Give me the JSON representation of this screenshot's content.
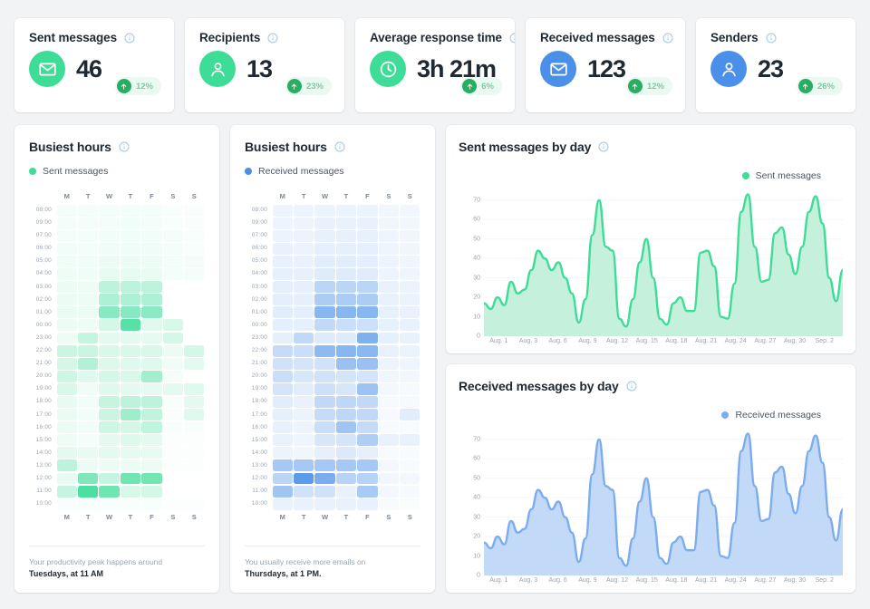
{
  "kpis": [
    {
      "title": "Sent messages",
      "value": "46",
      "trend": "12%",
      "icon": "envelope-icon",
      "bubble": "#3ddc97",
      "badge_bg": "#eafaf2"
    },
    {
      "title": "Recipients",
      "value": "13",
      "trend": "23%",
      "icon": "person-icon",
      "bubble": "#3ddc97",
      "badge_bg": "#eafaf2"
    },
    {
      "title": "Average response time",
      "value": "3h 21m",
      "trend": "6%",
      "icon": "clock-icon",
      "bubble": "#3ddc97",
      "badge_bg": "#eafaf2"
    },
    {
      "title": "Received messages",
      "value": "123",
      "trend": "12%",
      "icon": "envelope-icon",
      "bubble": "#4a90e8",
      "badge_bg": "#eafaf2"
    },
    {
      "title": "Senders",
      "value": "23",
      "trend": "26%",
      "icon": "person-icon",
      "bubble": "#4a90e8",
      "badge_bg": "#eafaf2"
    }
  ],
  "heatmaps": [
    {
      "title": "Busiest hours",
      "legend": "Sent messages",
      "accent": "#3ddc97",
      "days": [
        "M",
        "T",
        "W",
        "T",
        "F",
        "S",
        "S"
      ],
      "hours": [
        "08:00",
        "09:00",
        "07:00",
        "06:00",
        "05:00",
        "04:00",
        "03:00",
        "02:00",
        "01:00",
        "00:00",
        "23:00",
        "22:00",
        "21:00",
        "20:00",
        "19:00",
        "18:00",
        "17:00",
        "16:00",
        "15:00",
        "14:00",
        "13:00",
        "12:00",
        "11:00",
        "10:00"
      ],
      "insight_top": "Your productivity peak happens around",
      "insight_bottom": "Tuesdays, at 11 AM",
      "values": [
        [
          0.05,
          0.05,
          0.06,
          0.06,
          0.06,
          0.04,
          0.03
        ],
        [
          0.05,
          0.05,
          0.06,
          0.07,
          0.06,
          0.04,
          0.03
        ],
        [
          0.06,
          0.06,
          0.07,
          0.07,
          0.07,
          0.05,
          0.04
        ],
        [
          0.07,
          0.06,
          0.08,
          0.08,
          0.08,
          0.05,
          0.04
        ],
        [
          0.08,
          0.07,
          0.1,
          0.1,
          0.09,
          0.06,
          0.05
        ],
        [
          0.09,
          0.08,
          0.12,
          0.12,
          0.11,
          0.06,
          0.05
        ],
        [
          0.1,
          0.09,
          0.34,
          0.34,
          0.34,
          0.0,
          0.0
        ],
        [
          0.1,
          0.09,
          0.42,
          0.42,
          0.42,
          0.0,
          0.0
        ],
        [
          0.11,
          0.1,
          0.62,
          0.62,
          0.6,
          0.0,
          0.0
        ],
        [
          0.1,
          0.09,
          0.22,
          0.86,
          0.16,
          0.2,
          0.0
        ],
        [
          0.09,
          0.3,
          0.14,
          0.14,
          0.13,
          0.22,
          0.0
        ],
        [
          0.28,
          0.28,
          0.2,
          0.2,
          0.2,
          0.1,
          0.22
        ],
        [
          0.22,
          0.4,
          0.18,
          0.17,
          0.17,
          0.08,
          0.14
        ],
        [
          0.26,
          0.16,
          0.22,
          0.2,
          0.48,
          0.05,
          0.0
        ],
        [
          0.2,
          0.08,
          0.16,
          0.14,
          0.13,
          0.14,
          0.16
        ],
        [
          0.12,
          0.07,
          0.3,
          0.34,
          0.34,
          0.04,
          0.14
        ],
        [
          0.11,
          0.07,
          0.28,
          0.5,
          0.32,
          0.03,
          0.16
        ],
        [
          0.1,
          0.07,
          0.26,
          0.22,
          0.32,
          0.03,
          0.04
        ],
        [
          0.09,
          0.06,
          0.14,
          0.18,
          0.14,
          0.02,
          0.02
        ],
        [
          0.14,
          0.12,
          0.14,
          0.13,
          0.12,
          0.02,
          0.02
        ],
        [
          0.34,
          0.1,
          0.1,
          0.1,
          0.1,
          0.02,
          0.02
        ],
        [
          0.12,
          0.66,
          0.3,
          0.74,
          0.72,
          0.0,
          0.0
        ],
        [
          0.3,
          0.92,
          0.74,
          0.2,
          0.22,
          0.0,
          0.0
        ],
        [
          0.04,
          0.04,
          0.04,
          0.04,
          0.04,
          0.02,
          0.02
        ]
      ]
    },
    {
      "title": "Busiest hours",
      "legend": "Received messages",
      "accent": "#4a90e8",
      "days": [
        "M",
        "T",
        "W",
        "T",
        "F",
        "S",
        "S"
      ],
      "hours": [
        "08:00",
        "09:00",
        "07:00",
        "06:00",
        "05:00",
        "04:00",
        "03:00",
        "02:00",
        "01:00",
        "00:00",
        "23:00",
        "22:00",
        "21:00",
        "20:00",
        "19:00",
        "18:00",
        "17:00",
        "16:00",
        "15:00",
        "14:00",
        "13:00",
        "12:00",
        "11:00",
        "10:00"
      ],
      "insight_top": "You usually receive more emails on",
      "insight_bottom": "Thursdays, at 1 PM.",
      "values": [
        [
          0.1,
          0.1,
          0.11,
          0.11,
          0.11,
          0.08,
          0.07
        ],
        [
          0.1,
          0.1,
          0.12,
          0.12,
          0.12,
          0.08,
          0.07
        ],
        [
          0.11,
          0.11,
          0.13,
          0.13,
          0.13,
          0.09,
          0.08
        ],
        [
          0.12,
          0.11,
          0.14,
          0.14,
          0.14,
          0.09,
          0.08
        ],
        [
          0.13,
          0.12,
          0.16,
          0.16,
          0.15,
          0.1,
          0.09
        ],
        [
          0.14,
          0.13,
          0.18,
          0.18,
          0.17,
          0.1,
          0.09
        ],
        [
          0.15,
          0.14,
          0.38,
          0.38,
          0.38,
          0.12,
          0.11
        ],
        [
          0.15,
          0.14,
          0.46,
          0.46,
          0.46,
          0.12,
          0.11
        ],
        [
          0.16,
          0.15,
          0.66,
          0.66,
          0.66,
          0.13,
          0.12
        ],
        [
          0.15,
          0.14,
          0.34,
          0.3,
          0.28,
          0.13,
          0.12
        ],
        [
          0.14,
          0.34,
          0.18,
          0.18,
          0.7,
          0.14,
          0.12
        ],
        [
          0.32,
          0.3,
          0.62,
          0.66,
          0.64,
          0.12,
          0.11
        ],
        [
          0.26,
          0.24,
          0.26,
          0.56,
          0.56,
          0.1,
          0.09
        ],
        [
          0.3,
          0.22,
          0.26,
          0.24,
          0.24,
          0.08,
          0.07
        ],
        [
          0.24,
          0.16,
          0.28,
          0.22,
          0.54,
          0.06,
          0.05
        ],
        [
          0.16,
          0.12,
          0.34,
          0.36,
          0.34,
          0.05,
          0.05
        ],
        [
          0.14,
          0.11,
          0.32,
          0.36,
          0.34,
          0.05,
          0.16
        ],
        [
          0.13,
          0.1,
          0.3,
          0.52,
          0.32,
          0.04,
          0.04
        ],
        [
          0.12,
          0.09,
          0.22,
          0.24,
          0.44,
          0.12,
          0.12
        ],
        [
          0.11,
          0.08,
          0.14,
          0.2,
          0.14,
          0.04,
          0.04
        ],
        [
          0.5,
          0.5,
          0.5,
          0.5,
          0.5,
          0.06,
          0.04
        ],
        [
          0.38,
          0.9,
          0.74,
          0.4,
          0.4,
          0.08,
          0.06
        ],
        [
          0.52,
          0.26,
          0.26,
          0.12,
          0.48,
          0.06,
          0.05
        ],
        [
          0.12,
          0.12,
          0.12,
          0.12,
          0.12,
          0.04,
          0.03
        ]
      ]
    }
  ],
  "charts": [
    {
      "title": "Sent messages by day",
      "legend": "Sent messages",
      "chart_data": {
        "type": "area",
        "title": "Sent messages by day",
        "legend_position": "top-right",
        "series": [
          {
            "name": "Sent messages",
            "color": "#3ddc97",
            "fill": "#c5f0dc",
            "values": [
              17,
              14,
              20,
              16,
              28,
              22,
              24,
              34,
              44,
              40,
              34,
              38,
              30,
              22,
              7,
              19,
              52,
              70,
              46,
              44,
              9,
              5,
              19,
              38,
              50,
              30,
              9,
              6,
              17,
              20,
              13,
              13,
              43,
              44,
              36,
              10,
              9,
              27,
              64,
              73,
              46,
              28,
              29,
              53,
              56,
              42,
              32,
              46,
              64,
              72,
              58,
              30,
              18,
              34
            ]
          }
        ],
        "x": [
          "Aug. 1",
          "Aug. 3",
          "Aug. 6",
          "Aug. 9",
          "Aug. 12",
          "Aug. 15",
          "Aug. 18",
          "Aug. 21",
          "Aug. 24",
          "Aug. 27",
          "Aug. 30",
          "Sep. 2"
        ],
        "yticks": [
          0,
          10,
          20,
          30,
          40,
          50,
          60,
          70
        ],
        "ylim": [
          0,
          76
        ],
        "grid": true
      }
    },
    {
      "title": "Received messages by day",
      "legend": "Received messages",
      "chart_data": {
        "type": "area",
        "title": "Received messages by day",
        "legend_position": "top-right",
        "series": [
          {
            "name": "Received messages",
            "color": "#7badee",
            "fill": "#c2d9f7",
            "values": [
              17,
              14,
              20,
              16,
              28,
              22,
              24,
              34,
              44,
              40,
              34,
              38,
              30,
              22,
              7,
              19,
              52,
              70,
              46,
              44,
              9,
              5,
              19,
              38,
              50,
              30,
              9,
              6,
              17,
              20,
              13,
              13,
              43,
              44,
              36,
              10,
              9,
              27,
              64,
              73,
              46,
              28,
              29,
              53,
              56,
              42,
              32,
              46,
              64,
              72,
              58,
              30,
              18,
              34
            ]
          }
        ],
        "x": [
          "Aug. 1",
          "Aug. 3",
          "Aug. 6",
          "Aug. 9",
          "Aug. 12",
          "Aug. 15",
          "Aug. 18",
          "Aug. 21",
          "Aug. 24",
          "Aug. 27",
          "Aug. 30",
          "Sep. 2"
        ],
        "yticks": [
          0,
          10,
          20,
          30,
          40,
          50,
          60,
          70
        ],
        "ylim": [
          0,
          76
        ],
        "grid": true
      }
    }
  ]
}
